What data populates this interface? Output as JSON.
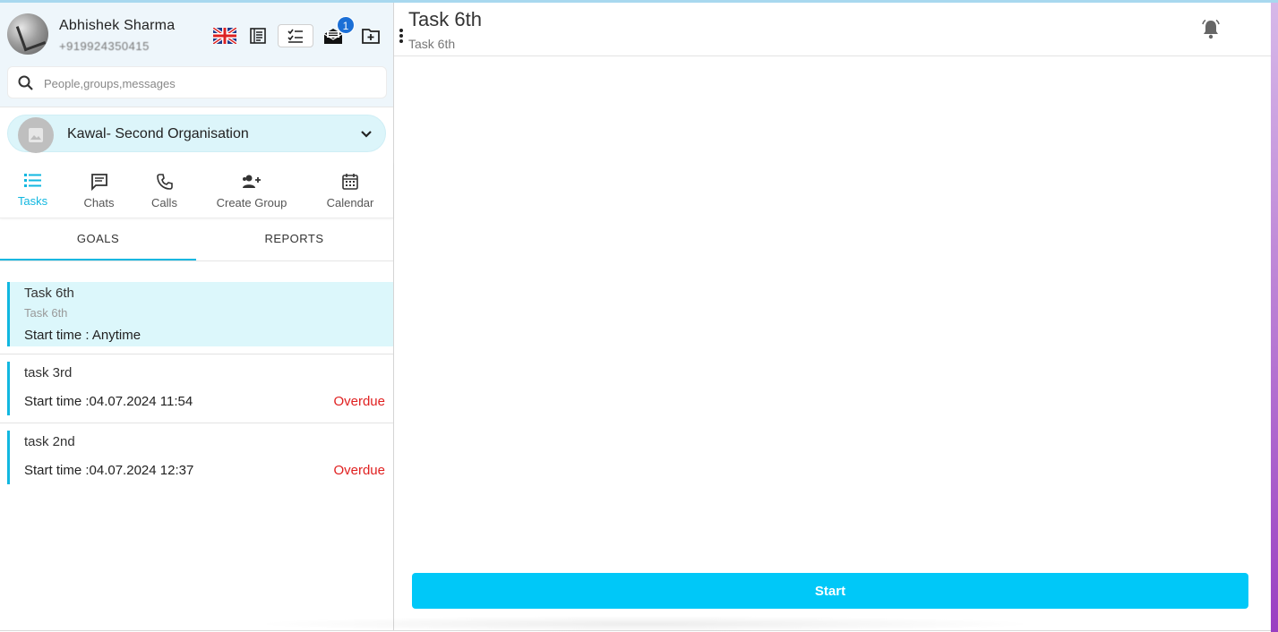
{
  "user": {
    "name": "Abhishek  Sharma",
    "phone": "+919924350415"
  },
  "header_icons": [
    "uk-flag-icon",
    "notes-icon",
    "checklist-icon",
    "mail-icon",
    "new-folder-icon",
    "more-vert-icon"
  ],
  "mail_badge": "1",
  "search": {
    "placeholder": "People,groups,messages"
  },
  "organisation": {
    "name": "Kawal- Second Organisation"
  },
  "nav": {
    "tasks": "Tasks",
    "chats": "Chats",
    "calls": "Calls",
    "create_group": "Create Group",
    "calendar": "Calendar"
  },
  "subtabs": {
    "goals": "GOALS",
    "reports": "REPORTS"
  },
  "tasks": [
    {
      "title": "Task 6th",
      "subtitle": "Task 6th",
      "start": "Start time :  Anytime",
      "status": ""
    },
    {
      "title": "task 3rd",
      "subtitle": "",
      "start": "Start time :04.07.2024 11:54",
      "status": "Overdue"
    },
    {
      "title": "task 2nd",
      "subtitle": "",
      "start": "Start time :04.07.2024 12:37",
      "status": "Overdue"
    }
  ],
  "detail": {
    "title": "Task 6th",
    "subtitle": "Task 6th",
    "start_button": "Start"
  },
  "colors": {
    "accent": "#11b7e0",
    "start_button": "#00c8f8",
    "overdue": "#e02020",
    "selected_bg": "#dcf7fb"
  }
}
